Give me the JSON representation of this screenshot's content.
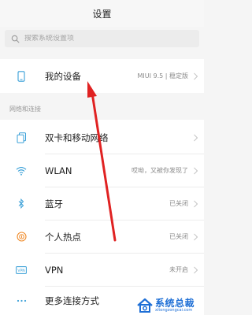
{
  "header": {
    "title": "设置"
  },
  "search": {
    "placeholder": "搜索系统设置项"
  },
  "device": {
    "label": "我的设备",
    "value": "MIUI 9.5 | 稳定版"
  },
  "section": {
    "network_label": "网络和连接"
  },
  "items": [
    {
      "label": "双卡和移动网络",
      "value": ""
    },
    {
      "label": "WLAN",
      "value": "哎呦，又被你发现了"
    },
    {
      "label": "蓝牙",
      "value": "已关闭"
    },
    {
      "label": "个人热点",
      "value": "已关闭"
    },
    {
      "label": "VPN",
      "value": "未开启"
    },
    {
      "label": "更多连接方式",
      "value": ""
    }
  ],
  "icons": {
    "device": "phone-icon",
    "sim": "sim-icon",
    "wlan": "wifi-icon",
    "bluetooth": "bluetooth-icon",
    "hotspot": "hotspot-icon",
    "vpn": "vpn-icon",
    "more": "more-dots-icon"
  },
  "colors": {
    "icon_blue": "#3aa0d8",
    "icon_orange": "#f08c2c",
    "annotation_red": "#e02222",
    "watermark_blue": "#1e6fd6"
  },
  "watermark": {
    "title": "系统总裁",
    "subtitle": "xitongzongcai.com"
  }
}
